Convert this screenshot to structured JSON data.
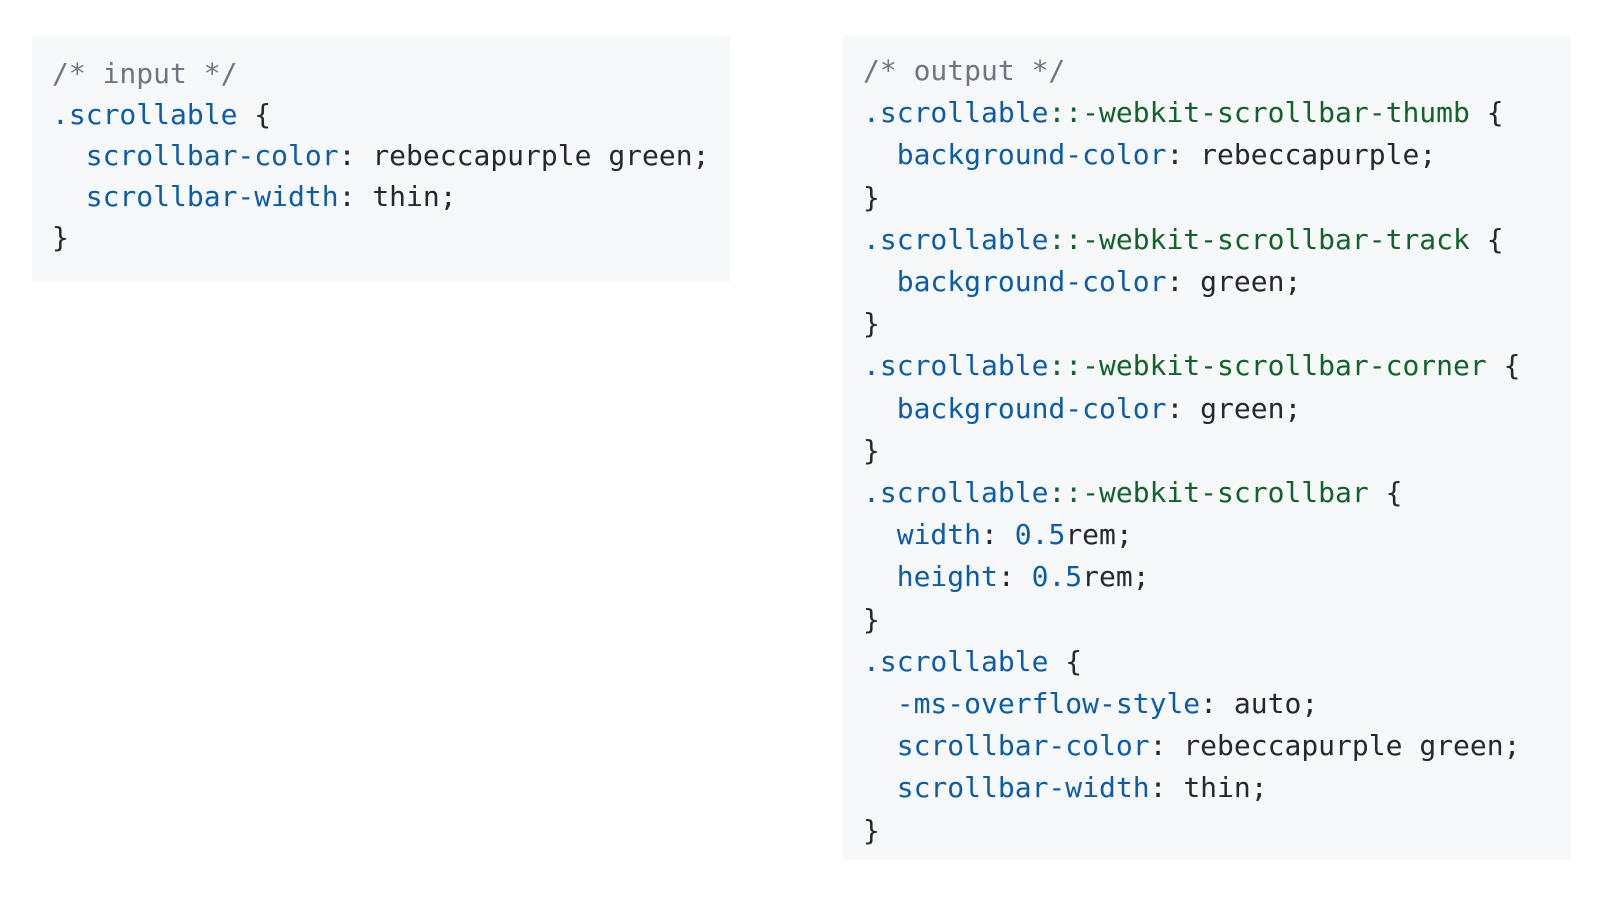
{
  "input_panel": {
    "comment": "/* input */",
    "selector": ".scrollable",
    "declarations": [
      {
        "property": "scrollbar-color",
        "value": "rebeccapurple green"
      },
      {
        "property": "scrollbar-width",
        "value": "thin"
      }
    ]
  },
  "output_panel": {
    "comment": "/* output */",
    "rules": [
      {
        "selector": ".scrollable",
        "pseudo": "::-webkit-scrollbar-thumb",
        "declarations": [
          {
            "property": "background-color",
            "value": "rebeccapurple"
          }
        ]
      },
      {
        "selector": ".scrollable",
        "pseudo": "::-webkit-scrollbar-track",
        "declarations": [
          {
            "property": "background-color",
            "value": "green"
          }
        ]
      },
      {
        "selector": ".scrollable",
        "pseudo": "::-webkit-scrollbar-corner",
        "declarations": [
          {
            "property": "background-color",
            "value": "green"
          }
        ]
      },
      {
        "selector": ".scrollable",
        "pseudo": "::-webkit-scrollbar",
        "declarations": [
          {
            "property": "width",
            "number": "0.5",
            "unit": "rem"
          },
          {
            "property": "height",
            "number": "0.5",
            "unit": "rem"
          }
        ]
      },
      {
        "selector": ".scrollable",
        "pseudo": "",
        "declarations": [
          {
            "property": "-ms-overflow-style",
            "value": "auto"
          },
          {
            "property": "scrollbar-color",
            "value": "rebeccapurple green"
          },
          {
            "property": "scrollbar-width",
            "value": "thin"
          }
        ]
      }
    ]
  },
  "colors": {
    "panel_background": "#f6f8fa",
    "comment": "#6e7781",
    "selector_and_property": "#0b5cad",
    "pseudo_element": "#116329",
    "text": "#24292f"
  }
}
